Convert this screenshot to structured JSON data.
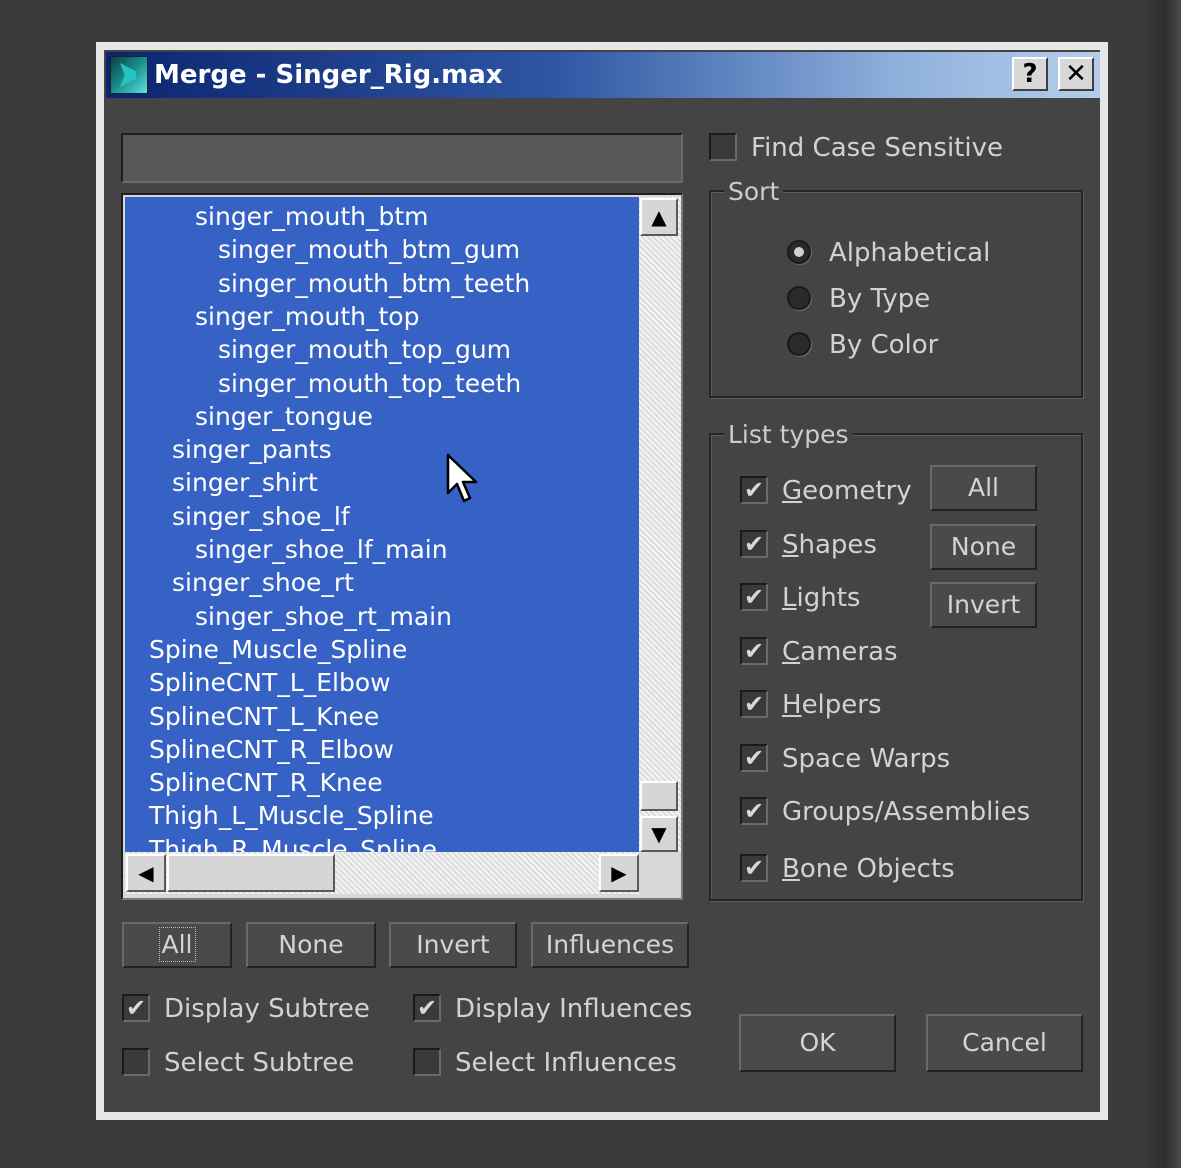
{
  "dialog": {
    "title": "Merge - Singer_Rig.max",
    "help_label": "?",
    "close_label": "✕",
    "search": {
      "value": "",
      "placeholder": ""
    },
    "object_list": [
      {
        "name": "singer_mouth_btm",
        "indent": 2
      },
      {
        "name": "singer_mouth_btm_gum",
        "indent": 3
      },
      {
        "name": "singer_mouth_btm_teeth",
        "indent": 3
      },
      {
        "name": "singer_mouth_top",
        "indent": 2
      },
      {
        "name": "singer_mouth_top_gum",
        "indent": 3
      },
      {
        "name": "singer_mouth_top_teeth",
        "indent": 3
      },
      {
        "name": "singer_tongue",
        "indent": 2
      },
      {
        "name": "singer_pants",
        "indent": 1
      },
      {
        "name": "singer_shirt",
        "indent": 1
      },
      {
        "name": "singer_shoe_lf",
        "indent": 1
      },
      {
        "name": "singer_shoe_lf_main",
        "indent": 2
      },
      {
        "name": "singer_shoe_rt",
        "indent": 1
      },
      {
        "name": "singer_shoe_rt_main",
        "indent": 2
      },
      {
        "name": "Spine_Muscle_Spline",
        "indent": 0
      },
      {
        "name": "SplineCNT_L_Elbow",
        "indent": 0
      },
      {
        "name": "SplineCNT_L_Knee",
        "indent": 0
      },
      {
        "name": "SplineCNT_R_Elbow",
        "indent": 0
      },
      {
        "name": "SplineCNT_R_Knee",
        "indent": 0
      },
      {
        "name": "Thigh_L_Muscle_Spline",
        "indent": 0
      },
      {
        "name": "Thigh_R_Muscle_Spline",
        "indent": 0
      }
    ],
    "list_buttons": {
      "all": "All",
      "none": "None",
      "invert": "Invert",
      "influences": "Influences"
    },
    "display_subtree": {
      "label": "Display Subtree",
      "checked": true
    },
    "select_subtree": {
      "label": "Select Subtree",
      "checked": false
    },
    "display_influences": {
      "label": "Display Influences",
      "checked": true
    },
    "select_influences": {
      "label": "Select Influences",
      "checked": false
    },
    "find_case_sensitive": {
      "label": "Find Case Sensitive",
      "checked": false
    },
    "sort": {
      "title": "Sort",
      "options": [
        "Alphabetical",
        "By Type",
        "By Color"
      ],
      "selected": "Alphabetical"
    },
    "list_types": {
      "title": "List types",
      "items": [
        {
          "label": "Geometry",
          "checked": true
        },
        {
          "label": "Shapes",
          "checked": true
        },
        {
          "label": "Lights",
          "checked": true
        },
        {
          "label": "Cameras",
          "checked": true
        },
        {
          "label": "Helpers",
          "checked": true
        },
        {
          "label": "Space Warps",
          "checked": true
        },
        {
          "label": "Groups/Assemblies",
          "checked": true
        },
        {
          "label": "Bone Objects",
          "checked": true
        }
      ],
      "buttons": {
        "all": "All",
        "none": "None",
        "invert": "Invert"
      }
    },
    "ok_label": "OK",
    "cancel_label": "Cancel",
    "check_glyph": "✔"
  }
}
